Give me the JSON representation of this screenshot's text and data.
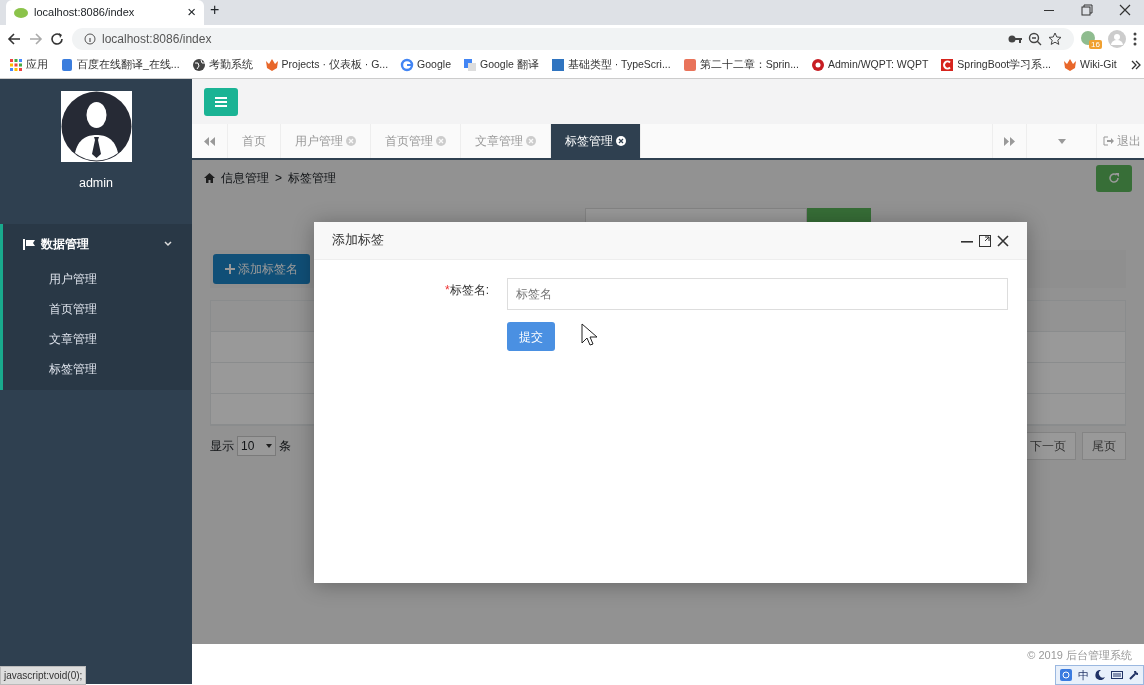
{
  "browser": {
    "tab_title": "localhost:8086/index",
    "tab_close": "×",
    "new_tab": "+",
    "address": "localhost:8086/index",
    "extension_badge": "16",
    "bookmarks": [
      {
        "label": "应用",
        "kind": "apps"
      },
      {
        "label": "百度在线翻译_在线...",
        "kind": "doc"
      },
      {
        "label": "考勤系统",
        "kind": "globe"
      },
      {
        "label": "Projects · 仪表板 · G...",
        "kind": "fox"
      },
      {
        "label": "Google",
        "kind": "google"
      },
      {
        "label": "Google 翻译",
        "kind": "translate"
      },
      {
        "label": "基础类型 · TypeScri...",
        "kind": "ts"
      },
      {
        "label": "第二十二章：Sprin...",
        "kind": "jian"
      },
      {
        "label": "Admin/WQPT: WQPT",
        "kind": "gitee"
      },
      {
        "label": "SpringBoot学习系...",
        "kind": "csdn"
      },
      {
        "label": "Wiki-Git",
        "kind": "fox"
      }
    ]
  },
  "sidebar": {
    "user": "admin",
    "menu": [
      {
        "label": "数据管理",
        "expanded": true,
        "children": [
          {
            "label": "用户管理"
          },
          {
            "label": "首页管理"
          },
          {
            "label": "文章管理"
          },
          {
            "label": "标签管理"
          }
        ]
      }
    ]
  },
  "tabs": [
    {
      "label": "首页",
      "closable": false,
      "selected": false
    },
    {
      "label": "用户管理",
      "closable": true,
      "selected": false
    },
    {
      "label": "首页管理",
      "closable": true,
      "selected": false
    },
    {
      "label": "文章管理",
      "closable": true,
      "selected": false
    },
    {
      "label": "标签管理",
      "closable": true,
      "selected": true
    }
  ],
  "logout": "退出",
  "breadcrumb": [
    "信息管理",
    ">",
    "标签管理"
  ],
  "toolbar": {
    "add_button": "添加标签名"
  },
  "pager": {
    "show": "显示",
    "page_size": "10",
    "unit": "条",
    "next": "下一页",
    "last": "尾页"
  },
  "footer": "© 2019 后台管理系统",
  "modal": {
    "title": "添加标签",
    "fields": [
      {
        "label": "标签名:",
        "required": true,
        "required_mark": "*",
        "placeholder": "标签名"
      }
    ],
    "submit": "提交"
  },
  "status_url": "javascript:void(0);",
  "ime": {
    "mode": "中"
  }
}
